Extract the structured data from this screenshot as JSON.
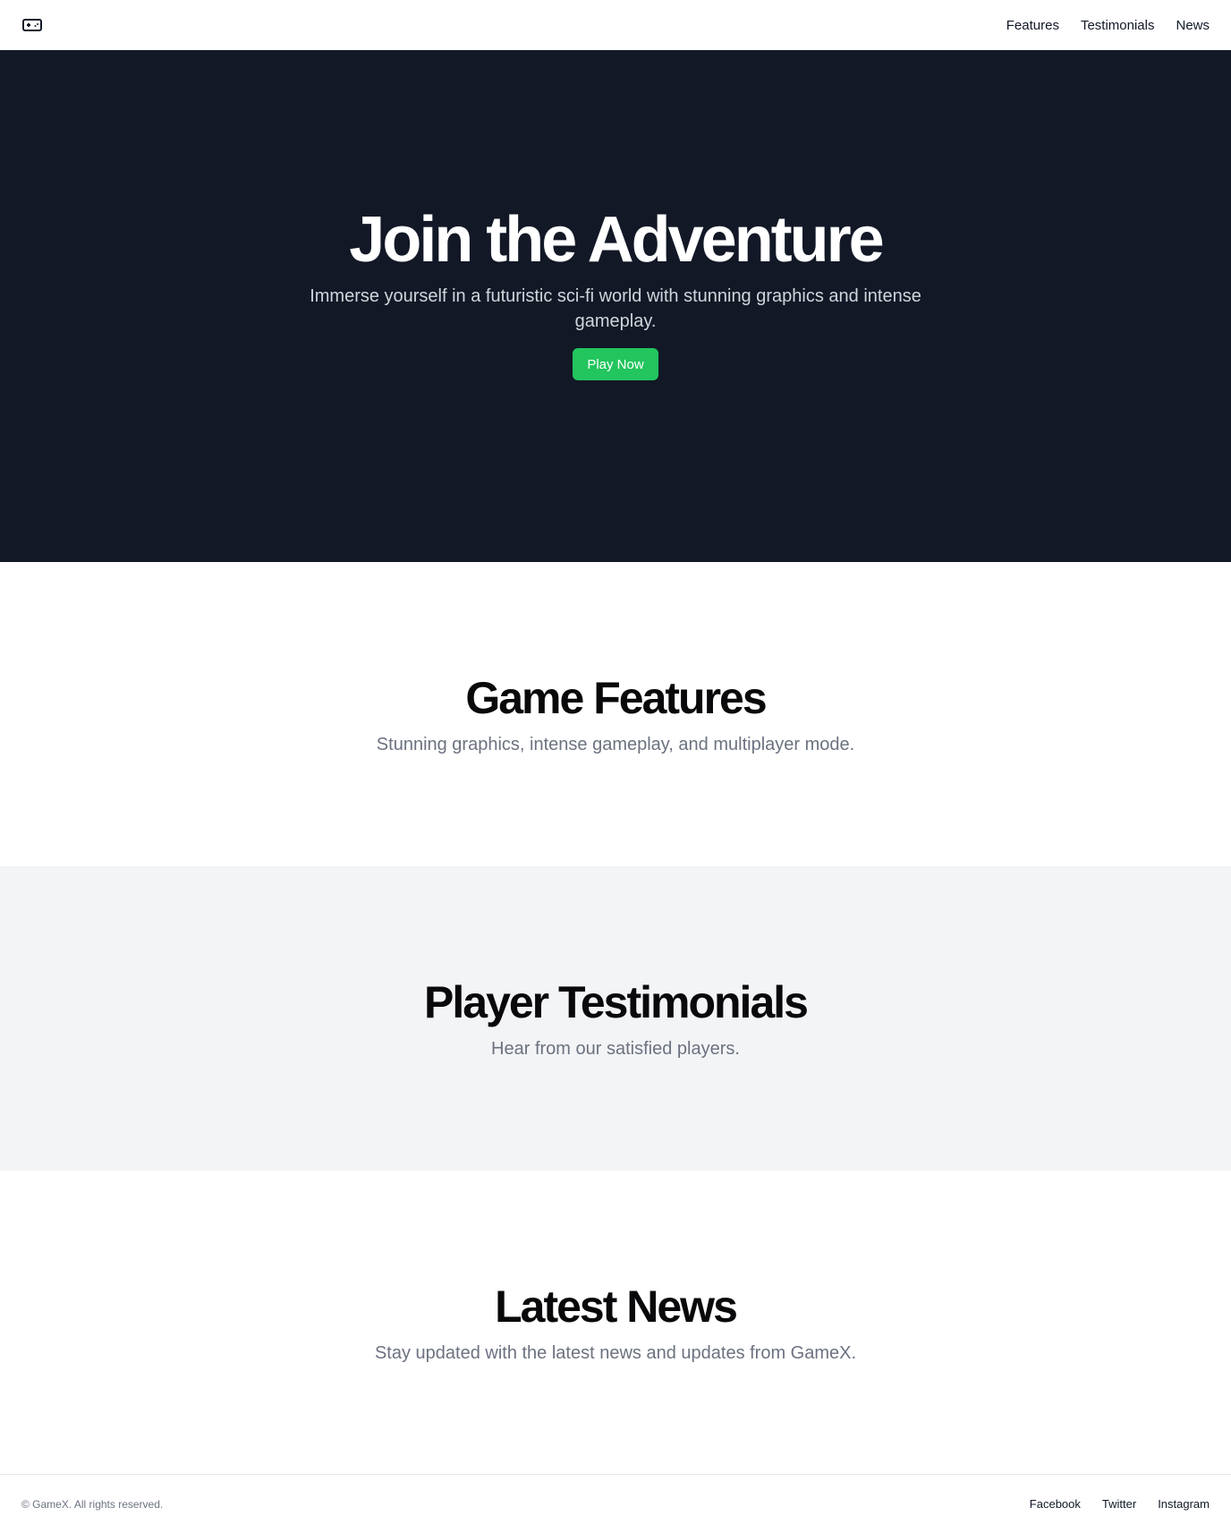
{
  "header": {
    "logo_icon": "gamepad-icon",
    "nav": [
      {
        "label": "Features"
      },
      {
        "label": "Testimonials"
      },
      {
        "label": "News"
      }
    ]
  },
  "hero": {
    "title": "Join the Adventure",
    "subtitle": "Immerse yourself in a futuristic sci-fi world with stunning graphics and intense gameplay.",
    "cta_label": "Play Now",
    "background_color": "#121826",
    "cta_color": "#22c55e"
  },
  "sections": {
    "features": {
      "title": "Game Features",
      "subtitle": "Stunning graphics, intense gameplay, and multiplayer mode."
    },
    "testimonials": {
      "title": "Player Testimonials",
      "subtitle": "Hear from our satisfied players."
    },
    "news": {
      "title": "Latest News",
      "subtitle": "Stay updated with the latest news and updates from GameX."
    }
  },
  "footer": {
    "copyright": "© GameX. All rights reserved.",
    "links": [
      {
        "label": "Facebook"
      },
      {
        "label": "Twitter"
      },
      {
        "label": "Instagram"
      }
    ]
  }
}
